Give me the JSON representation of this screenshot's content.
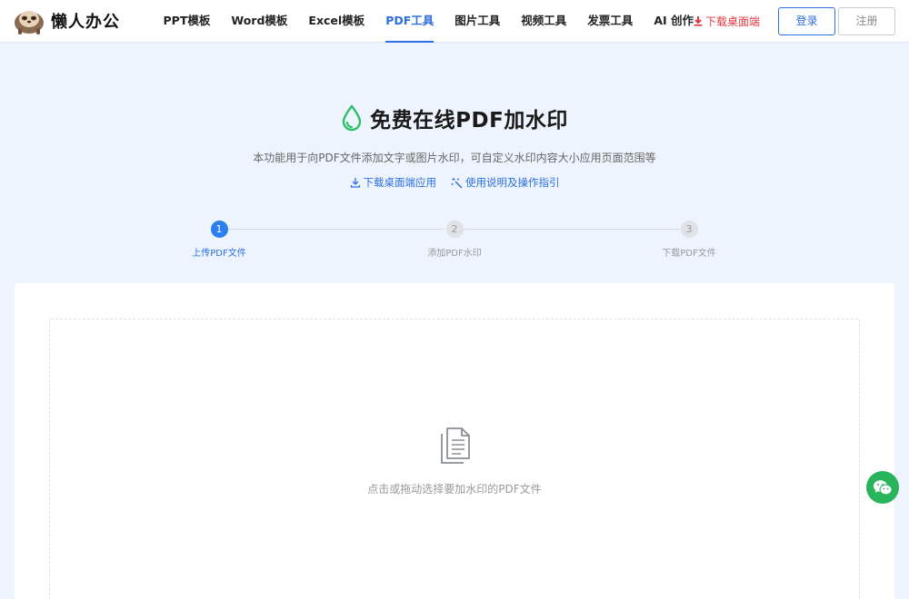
{
  "brand": {
    "name": "懒人办公",
    "logo_icon": "sloth-logo-icon"
  },
  "nav": {
    "items": [
      {
        "label": "PPT模板",
        "active": false
      },
      {
        "label": "Word模板",
        "active": false
      },
      {
        "label": "Excel模板",
        "active": false
      },
      {
        "label": "PDF工具",
        "active": true
      },
      {
        "label": "图片工具",
        "active": false
      },
      {
        "label": "视频工具",
        "active": false
      },
      {
        "label": "发票工具",
        "active": false
      },
      {
        "label": "AI 创作",
        "active": false
      }
    ],
    "download_label": "下载桌面端",
    "login_label": "登录",
    "register_label": "注册"
  },
  "hero": {
    "title": "免费在线PDF加水印",
    "description": "本功能用于向PDF文件添加文字或图片水印，可自定义水印内容大小应用页面范围等",
    "links": {
      "download_app": "下载桌面端应用",
      "guide": "使用说明及操作指引"
    }
  },
  "steps": [
    {
      "number": "1",
      "label": "上传PDF文件",
      "active": true
    },
    {
      "number": "2",
      "label": "添加PDF水印",
      "active": false
    },
    {
      "number": "3",
      "label": "下载PDF文件",
      "active": false
    }
  ],
  "upload": {
    "prompt": "点击或拖动选择要加水印的PDF文件"
  },
  "colors": {
    "accent": "#2d6fe0",
    "download_red": "#e0383e",
    "drop_green": "#2bbf6a",
    "wechat_green": "#27b45a",
    "page_bg": "#eef4fd"
  }
}
